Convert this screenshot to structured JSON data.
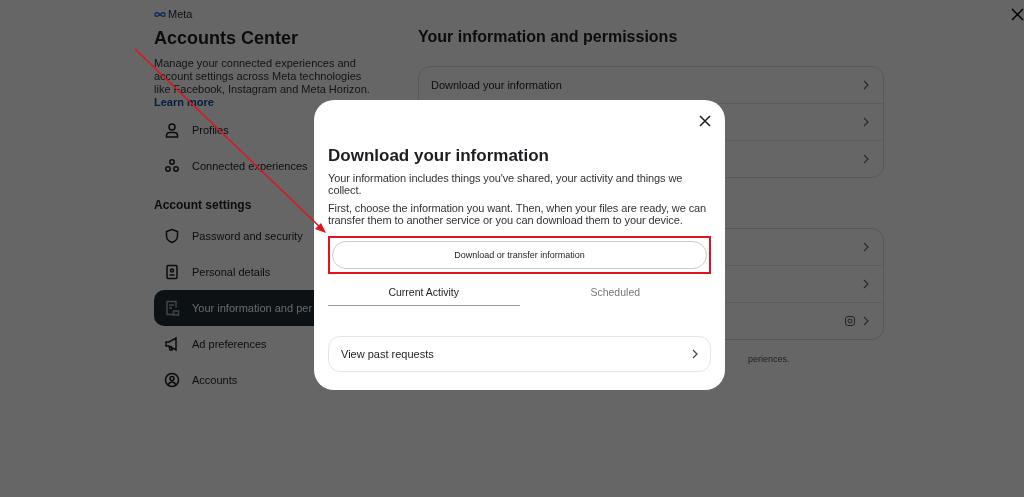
{
  "brand": "Meta",
  "sidebar": {
    "title": "Accounts Center",
    "description": "Manage your connected experiences and account settings across Meta technologies like Facebook, Instagram and Meta Horizon.",
    "link": "Learn more",
    "items": [
      {
        "label": "Profiles",
        "selected": false
      },
      {
        "label": "Connected experiences",
        "selected": false
      }
    ],
    "section": "Account settings",
    "settings": [
      {
        "label": "Password and security",
        "selected": false
      },
      {
        "label": "Personal details",
        "selected": false
      },
      {
        "label": "Your information and per",
        "selected": true
      },
      {
        "label": "Ad preferences",
        "selected": false
      },
      {
        "label": "Accounts",
        "selected": false
      }
    ]
  },
  "main": {
    "title": "Your information and permissions",
    "cards": [
      {
        "rows": [
          {
            "label": "Download your information"
          },
          {},
          {}
        ]
      },
      {
        "rows": [
          {},
          {},
          {
            "instagram": true
          }
        ]
      }
    ],
    "footnote": "periences."
  },
  "dialog": {
    "title": "Download your information",
    "paragraphs": [
      "Your information includes things you've shared, your activity and things we collect.",
      "First, choose the information you want. Then, when your files are ready, we can transfer them to another service or you can download them to your device."
    ],
    "button": "Download or transfer information",
    "tabs": [
      {
        "label": "Current Activity",
        "selected": true
      },
      {
        "label": "Scheduled",
        "selected": false
      }
    ],
    "link_row": "View past requests"
  }
}
